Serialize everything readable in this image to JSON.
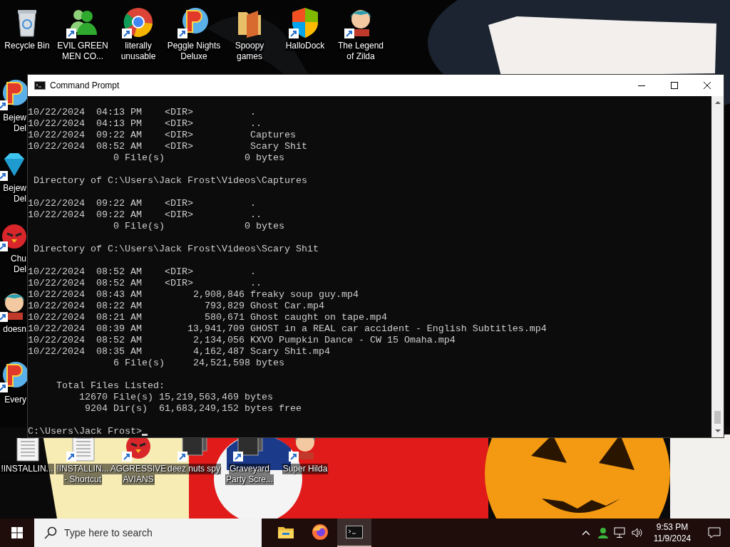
{
  "desktop": {
    "top_icons": [
      {
        "kind": "recycle-bin",
        "shortcut": false,
        "label": [
          "Recycle Bin"
        ]
      },
      {
        "kind": "people",
        "shortcut": true,
        "label": [
          "EVIL GREEN",
          "MEN CO..."
        ]
      },
      {
        "kind": "browser",
        "shortcut": true,
        "label": [
          "literally",
          "unusable"
        ]
      },
      {
        "kind": "game",
        "shortcut": true,
        "label": [
          "Peggle Nights",
          "Deluxe"
        ]
      },
      {
        "kind": "folder",
        "shortcut": false,
        "label": [
          "Spoopy",
          "games"
        ]
      },
      {
        "kind": "shield",
        "shortcut": true,
        "label": [
          "HalloDock"
        ]
      },
      {
        "kind": "character",
        "shortcut": true,
        "label": [
          "The Legend",
          "of Zilda"
        ]
      }
    ],
    "left_icons": [
      {
        "kind": "game",
        "shortcut": true,
        "label": [
          "Bejew",
          "Del"
        ]
      },
      {
        "kind": "gem",
        "shortcut": true,
        "label": [
          "Bejew",
          "Del"
        ]
      },
      {
        "kind": "bird",
        "shortcut": true,
        "label": [
          "Chu",
          "Del"
        ]
      },
      {
        "kind": "character",
        "shortcut": true,
        "label": [
          "doesn"
        ]
      },
      {
        "kind": "game",
        "shortcut": true,
        "label": [
          "Every"
        ]
      }
    ],
    "bottom_icons": [
      {
        "kind": "document",
        "shortcut": false,
        "label": [
          "!INSTALLIN..."
        ]
      },
      {
        "kind": "document",
        "shortcut": true,
        "label": [
          "!INSTALLIN...",
          "- Shortcut"
        ]
      },
      {
        "kind": "bird",
        "shortcut": true,
        "label": [
          "AGGRESSIVE",
          "AVIANS"
        ]
      },
      {
        "kind": "app",
        "shortcut": true,
        "label": [
          "deez nuts spy"
        ]
      },
      {
        "kind": "app",
        "shortcut": true,
        "label": [
          "Graveyard",
          "Party Scre..."
        ]
      },
      {
        "kind": "character",
        "shortcut": true,
        "label": [
          "Super Hilda"
        ]
      }
    ]
  },
  "window": {
    "title": "Command Prompt",
    "console_blocks": [
      [
        "10/22/2024  04:13 PM    <DIR>          .",
        "10/22/2024  04:13 PM    <DIR>          ..",
        "10/22/2024  09:22 AM    <DIR>          Captures",
        "10/22/2024  08:52 AM    <DIR>          Scary Shit",
        "               0 File(s)              0 bytes"
      ],
      [
        " Directory of C:\\Users\\Jack Frost\\Videos\\Captures"
      ],
      [
        "10/22/2024  09:22 AM    <DIR>          .",
        "10/22/2024  09:22 AM    <DIR>          ..",
        "               0 File(s)              0 bytes"
      ],
      [
        " Directory of C:\\Users\\Jack Frost\\Videos\\Scary Shit"
      ],
      [
        "10/22/2024  08:52 AM    <DIR>          .",
        "10/22/2024  08:52 AM    <DIR>          ..",
        "10/22/2024  08:43 AM         2,908,846 freaky soup guy.mp4",
        "10/22/2024  08:22 AM           793,829 Ghost Car.mp4",
        "10/22/2024  08:21 AM           580,671 Ghost caught on tape.mp4",
        "10/22/2024  08:39 AM        13,941,709 GHOST in a REAL car accident - English Subtitles.mp4",
        "10/22/2024  08:52 AM         2,134,056 KXVO Pumpkin Dance - CW 15 Omaha.mp4",
        "10/22/2024  08:35 AM         4,162,487 Scary Shit.mp4",
        "               6 File(s)     24,521,598 bytes"
      ],
      [
        "     Total Files Listed:",
        "         12670 File(s) 15,219,563,469 bytes",
        "          9204 Dir(s)  61,683,249,152 bytes free"
      ],
      [
        "C:\\Users\\Jack Frost>"
      ]
    ]
  },
  "taskbar": {
    "search": {
      "placeholder": "Type here to search"
    },
    "apps": [
      {
        "kind": "explorer",
        "selected": false
      },
      {
        "kind": "firefox",
        "selected": false
      },
      {
        "kind": "terminal",
        "selected": true
      }
    ],
    "time": "9:53 PM",
    "date": "11/9/2024"
  }
}
